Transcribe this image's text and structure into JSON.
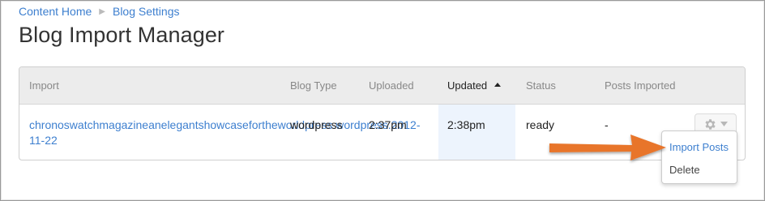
{
  "breadcrumb": {
    "items": [
      "Content Home",
      "Blog Settings"
    ]
  },
  "page": {
    "title": "Blog Import Manager"
  },
  "table": {
    "headers": [
      "Import",
      "Blog Type",
      "Uploaded",
      "Updated",
      "Status",
      "Posts Imported"
    ],
    "sorted_column": "Updated",
    "rows": [
      {
        "import_line1": "chronoswatchmagazineanelegantshowcasefortheworldpress.wordpress.2012-",
        "import_line2": "11-22",
        "blog_type": "wordpress",
        "uploaded": "2:37pm",
        "updated": "2:38pm",
        "status": "ready",
        "posts_imported": "-"
      }
    ]
  },
  "actions_menu": {
    "items": [
      "Import Posts",
      "Delete"
    ],
    "highlighted": "Import Posts"
  },
  "colors": {
    "link": "#3d7fcf",
    "arrow": "#e8752a",
    "header_bg": "#ececec",
    "sorted_column_bg": "#edf4fd"
  },
  "icons": {
    "breadcrumb_separator": "triangle-right",
    "actions": "gear-icon",
    "sort": "caret-up-icon",
    "annotation": "orange-arrow"
  }
}
